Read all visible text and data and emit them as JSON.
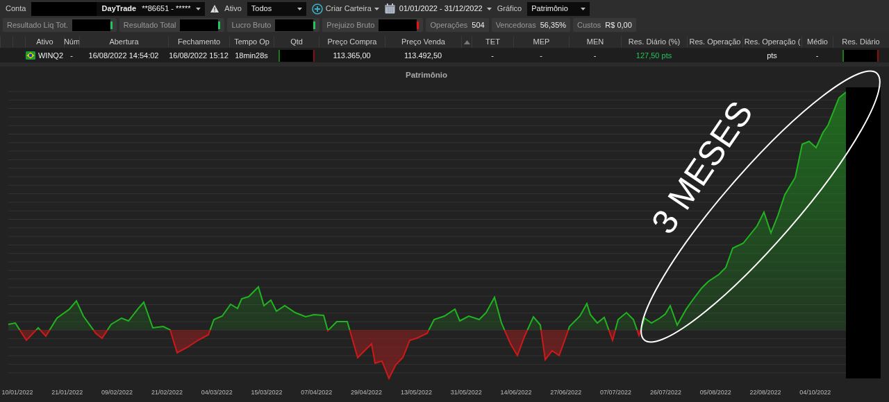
{
  "toolbar": {
    "account": {
      "label": "Conta",
      "name": "DayTrade",
      "number": "**86651 - *****"
    },
    "asset_filter": {
      "label": "Ativo",
      "value": "Todos"
    },
    "create_portfolio": "Criar Carteira",
    "date_range": "01/01/2022 - 31/12/2022",
    "chart_select": {
      "label": "Gráfico",
      "value": "Patrimônio"
    }
  },
  "summary": [
    {
      "label": "Resultado Liq Tot.",
      "kind": "redacted",
      "color": "#22c55e"
    },
    {
      "label": "Resultado Total",
      "kind": "redacted",
      "color": "#22c55e"
    },
    {
      "label": "Lucro Bruto",
      "kind": "redacted",
      "color": "#22c55e"
    },
    {
      "label": "Prejuizo Bruto",
      "kind": "redacted",
      "color": "#ee1111"
    },
    {
      "label": "Operações",
      "kind": "value",
      "value": "504"
    },
    {
      "label": "Vencedoras",
      "kind": "value",
      "value": "56,35%"
    },
    {
      "label": "Custos",
      "kind": "value",
      "value": "R$ 0,00"
    }
  ],
  "table": {
    "columns": [
      {},
      {},
      {
        "label": "Ativo"
      },
      {
        "label": "Núm"
      },
      {
        "label": "Abertura"
      },
      {
        "label": "Fechamento"
      },
      {
        "label": "Tempo Op"
      },
      {
        "label": "Qtd"
      },
      {
        "label": "Preço Compra"
      },
      {
        "label": "Preço Venda"
      },
      {
        "sorted": true
      },
      {
        "label": "TET"
      },
      {
        "label": "MEP"
      },
      {
        "label": "MEN"
      },
      {
        "label": "Res. Diário (%)"
      },
      {
        "label": "Res. Operação"
      },
      {
        "label": "Res. Operação ("
      },
      {
        "label": "Médio"
      },
      {
        "label": "Res. Diário"
      }
    ],
    "rows": [
      {
        "cells": [
          {
            "kind": "empty"
          },
          {
            "kind": "empty"
          },
          {
            "kind": "asset",
            "text": "WINQ2"
          },
          {
            "kind": "text",
            "text": "-"
          },
          {
            "kind": "text",
            "text": "16/08/2022 14:54:02"
          },
          {
            "kind": "text",
            "text": "16/08/2022 15:12"
          },
          {
            "kind": "text",
            "text": "18min28s"
          },
          {
            "kind": "redacted"
          },
          {
            "kind": "text",
            "text": "113.365,00"
          },
          {
            "kind": "text",
            "text": "113.492,50"
          },
          {
            "kind": "empty"
          },
          {
            "kind": "text",
            "text": "-"
          },
          {
            "kind": "text",
            "text": "-"
          },
          {
            "kind": "text",
            "text": "-"
          },
          {
            "kind": "text",
            "text": "127,50 pts",
            "color": "#22c55e"
          },
          {
            "kind": "empty"
          },
          {
            "kind": "text",
            "text": "pts"
          },
          {
            "kind": "text",
            "text": "-"
          },
          {
            "kind": "redacted"
          }
        ]
      }
    ]
  },
  "chart": {
    "title": "Patrimônio",
    "x_labels": [
      "10/01/2022",
      "21/01/2022",
      "09/02/2022",
      "21/02/2022",
      "04/03/2022",
      "15/03/2022",
      "07/04/2022",
      "29/04/2022",
      "13/05/2022",
      "31/05/2022",
      "14/06/2022",
      "27/06/2022",
      "07/07/2022",
      "26/07/2022",
      "05/08/2022",
      "22/08/2022",
      "04/10/2022"
    ],
    "annotation": "3 MESES"
  }
}
